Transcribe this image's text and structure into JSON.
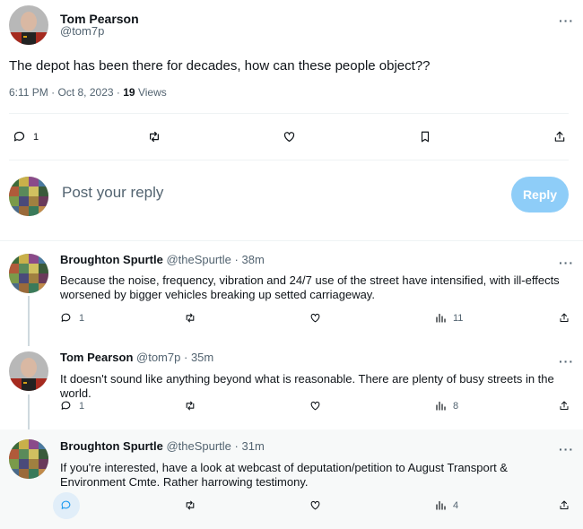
{
  "main_tweet": {
    "author_name": "Tom Pearson",
    "author_handle": "@tom7p",
    "text": "The depot has been there for decades, how can these people object??",
    "time": "6:11 PM",
    "date": "Oct 8, 2023",
    "views_count": "19",
    "views_label": "Views",
    "reply_count": "1",
    "more_label": "···"
  },
  "composer": {
    "placeholder": "Post your reply",
    "button_label": "Reply"
  },
  "replies": [
    {
      "author_name": "Broughton Spurtle",
      "author_handle": "@theSpurtle",
      "time": "38m",
      "text": "Because the noise, frequency, vibration and 24/7 use of the street have intensified, with ill-effects worsened by bigger vehicles breaking up setted carriageway.",
      "reply_count": "1",
      "views_count": "11"
    },
    {
      "author_name": "Tom Pearson",
      "author_handle": "@tom7p",
      "time": "35m",
      "text": "It doesn't sound like anything beyond what is reasonable. There are plenty of busy streets in the world.",
      "reply_count": "1",
      "views_count": "8"
    },
    {
      "author_name": "Broughton Spurtle",
      "author_handle": "@theSpurtle",
      "time": "31m",
      "text": "If you're interested, have a look at webcast of deputation/petition to August Transport & Environment Cmte. Rather harrowing testimony.",
      "reply_count": "",
      "views_count": "4"
    }
  ],
  "separator": "·",
  "colors": {
    "accent": "#1d9bf0",
    "reply_button": "#8ecdf8",
    "secondary_text": "#536471",
    "highlight_bg": "#f7f9f9"
  },
  "icons": [
    "reply-icon",
    "retweet-icon",
    "like-icon",
    "bookmark-icon",
    "share-icon",
    "views-icon",
    "more-icon"
  ]
}
